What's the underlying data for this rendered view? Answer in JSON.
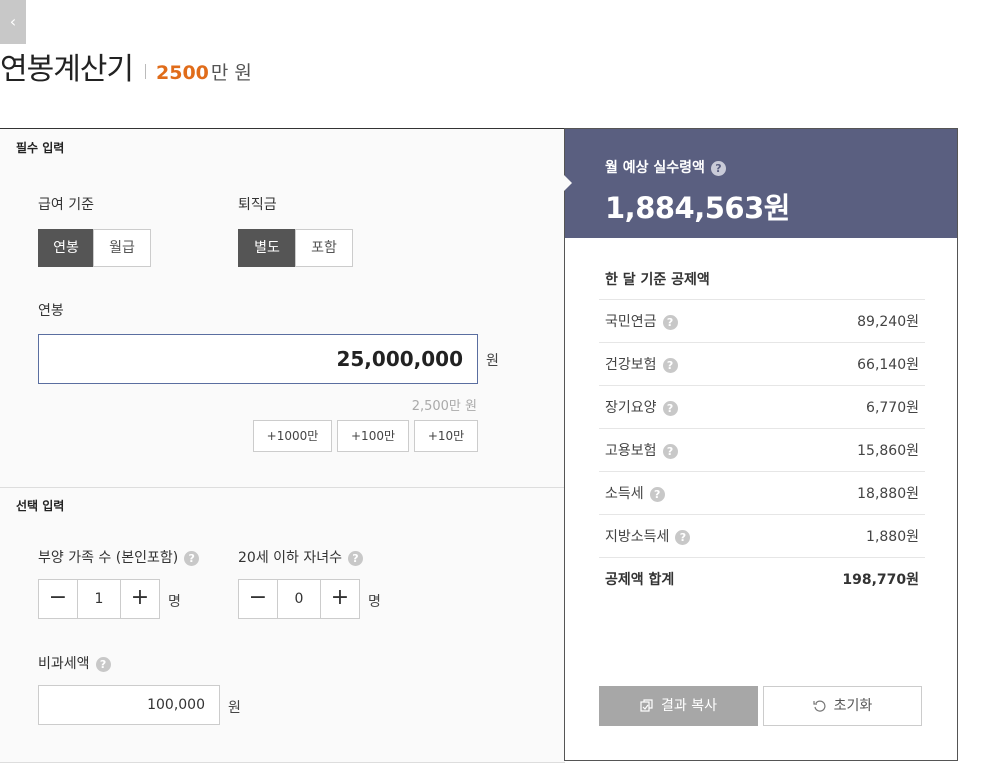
{
  "header": {
    "back_icon": "chevron-left-icon",
    "back_glyph": "‹",
    "title": "연봉계산기",
    "amount": "2500",
    "amount_unit": "만 원"
  },
  "colors": {
    "accent_orange": "#e06c1a",
    "result_bg": "#5a5f80",
    "input_border_active": "#5a6ea0"
  },
  "required": {
    "section_title": "필수 입력",
    "pay_basis": {
      "label": "급여 기준",
      "options": [
        "연봉",
        "월급"
      ],
      "selected": "연봉"
    },
    "severance": {
      "label": "퇴직금",
      "options": [
        "별도",
        "포함"
      ],
      "selected": "별도"
    },
    "salary": {
      "label": "연봉",
      "value": "25,000,000",
      "unit": "원",
      "hint": "2,500만  원",
      "add_buttons": [
        "+1000만",
        "+100만",
        "+10만"
      ]
    }
  },
  "optional": {
    "section_title": "선택 입력",
    "dependents": {
      "label": "부양 가족 수 (본인포함)",
      "value": "1",
      "unit": "명"
    },
    "children": {
      "label": "20세 이하 자녀수",
      "value": "0",
      "unit": "명"
    },
    "nontax": {
      "label": "비과세액",
      "value": "100,000",
      "unit": "원"
    },
    "help_glyph": "?",
    "minus_glyph": "−",
    "plus_glyph": "+"
  },
  "result": {
    "label": "월 예상 실수령액",
    "value": "1,884,563원",
    "deductions_title": "한 달 기준 공제액",
    "deductions": [
      {
        "name": "국민연금",
        "amount": "89,240원"
      },
      {
        "name": "건강보험",
        "amount": "66,140원"
      },
      {
        "name": "장기요양",
        "amount": "6,770원"
      },
      {
        "name": "고용보험",
        "amount": "15,860원"
      },
      {
        "name": "소득세",
        "amount": "18,880원"
      },
      {
        "name": "지방소득세",
        "amount": "1,880원"
      }
    ],
    "total": {
      "name": "공제액 합계",
      "amount": "198,770원"
    },
    "copy_button": "결과 복사",
    "reset_button": "초기화",
    "copy_icon": "copy-icon",
    "reset_icon": "reset-icon"
  }
}
